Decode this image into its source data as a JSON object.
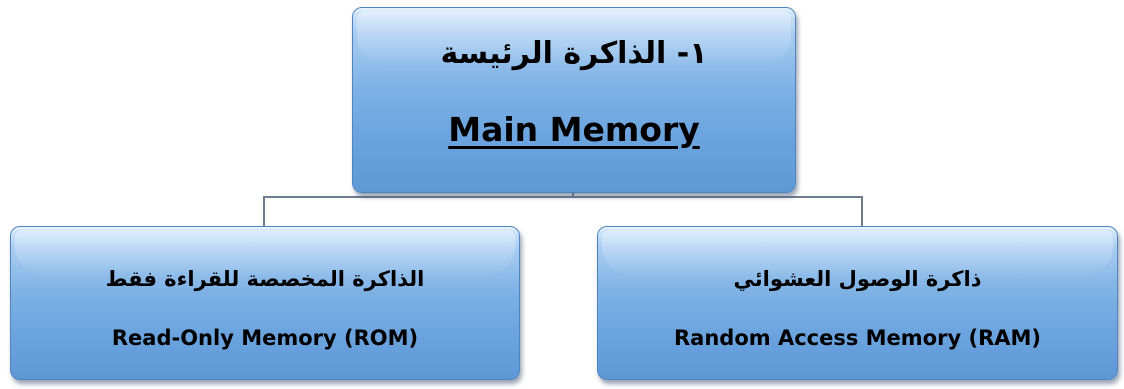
{
  "diagram": {
    "root": {
      "label_ar": "١- الذاكرة الرئيسة",
      "label_en": "Main Memory"
    },
    "children": [
      {
        "label_ar": "الذاكرة المخصصة للقراءة فقط",
        "label_en": "Read-Only Memory (ROM)"
      },
      {
        "label_ar": "ذاكرة الوصول العشوائي",
        "label_en": "Random Access Memory (RAM)"
      }
    ],
    "colors": {
      "box_fill": "#6aa3de",
      "box_highlight": "#d7e9fb",
      "connector": "#6d7d8c"
    }
  }
}
